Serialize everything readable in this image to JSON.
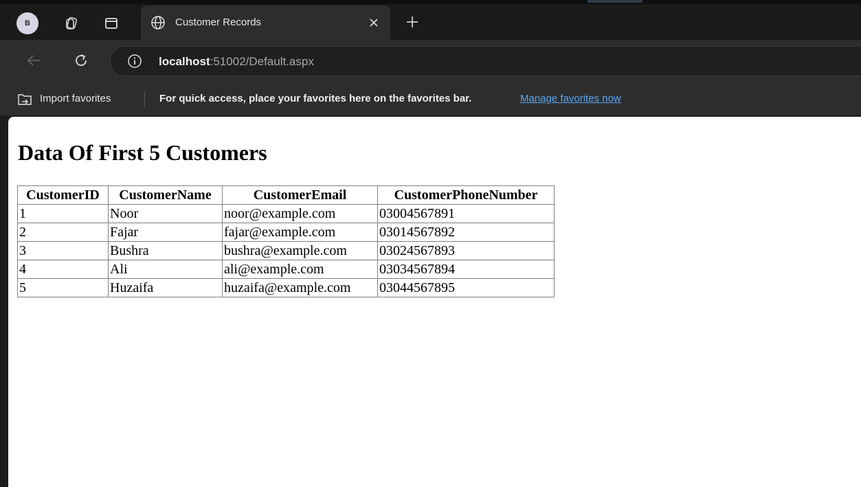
{
  "browser": {
    "profile_initial": "B",
    "tab_title": "Customer Records",
    "url_host": "localhost",
    "url_path": ":51002/Default.aspx",
    "favorites": {
      "import_label": "Import favorites",
      "hint": "For quick access, place your favorites here on the favorites bar.",
      "manage_link": "Manage favorites now"
    }
  },
  "page": {
    "heading": "Data Of First 5 Customers",
    "table": {
      "headers": [
        "CustomerID",
        "CustomerName",
        "CustomerEmail",
        "CustomerPhoneNumber"
      ],
      "rows": [
        [
          "1",
          "Noor",
          "noor@example.com",
          "03004567891"
        ],
        [
          "2",
          "Fajar",
          "fajar@example.com",
          "03014567892"
        ],
        [
          "3",
          "Bushra",
          "bushra@example.com",
          "03024567893"
        ],
        [
          "4",
          "Ali",
          "ali@example.com",
          "03034567894"
        ],
        [
          "5",
          "Huzaifa",
          "huzaifa@example.com",
          "03044567895"
        ]
      ]
    }
  },
  "colors": {
    "link": "#5aa8f0",
    "chrome_dark": "#1a1a1a",
    "chrome_mid": "#2d2d2d"
  }
}
